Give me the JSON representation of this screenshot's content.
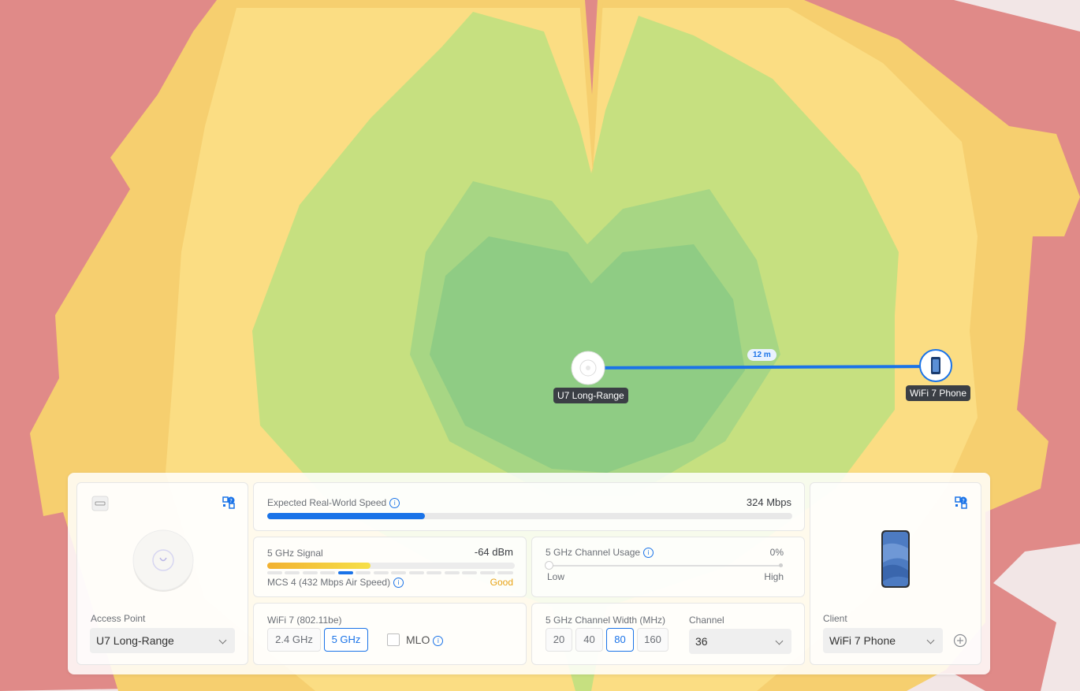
{
  "map": {
    "ap_label": "U7 Long-Range",
    "client_label": "WiFi 7 Phone",
    "distance": "12 m"
  },
  "colors": {
    "accent": "#1a73e8",
    "zone_red": "#e08a88",
    "zone_orange": "#f6cf6f",
    "zone_yellow": "#fbdd83",
    "zone_lightgreen": "#c6e080",
    "zone_green": "#8fcc84"
  },
  "ap_card": {
    "icon": "device-badge-icon",
    "help_icon": "qr-help-icon",
    "label": "Access Point",
    "selected": "U7 Long-Range"
  },
  "speed": {
    "label": "Expected Real-World Speed",
    "value": "324 Mbps",
    "fill_fraction": 0.3
  },
  "signal": {
    "label": "5 GHz Signal",
    "value": "-64 dBm",
    "mcs": "MCS 4 (432 Mbps Air Speed)",
    "quality": "Good",
    "fill_fraction": 0.42
  },
  "usage": {
    "label": "5 GHz Channel Usage",
    "value": "0%",
    "low": "Low",
    "high": "High",
    "level": 0
  },
  "wifi": {
    "label": "WiFi 7 (802.11be)",
    "bands": [
      "2.4 GHz",
      "5 GHz"
    ],
    "active_band": "5 GHz",
    "mlo": "MLO"
  },
  "width": {
    "label": "5 GHz Channel Width (MHz)",
    "options": [
      "20",
      "40",
      "80",
      "160"
    ],
    "active": "80",
    "channel_label": "Channel",
    "channel_value": "36"
  },
  "client_card": {
    "help_icon": "qr-help-icon",
    "label": "Client",
    "selected": "WiFi 7 Phone",
    "add_icon": "plus-circle-icon"
  }
}
